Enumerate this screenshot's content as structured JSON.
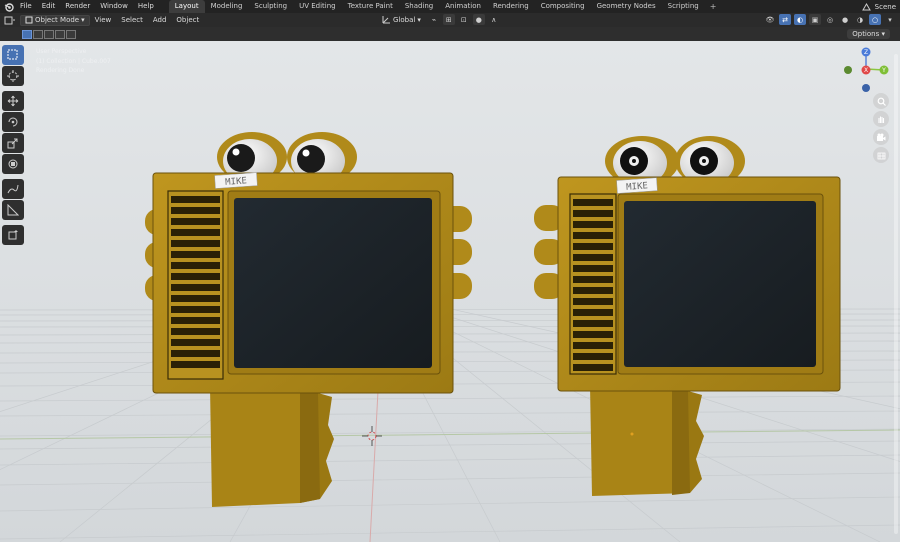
{
  "menubar": {
    "items": [
      "File",
      "Edit",
      "Render",
      "Window",
      "Help"
    ],
    "workspaces": [
      "Layout",
      "Modeling",
      "Sculpting",
      "UV Editing",
      "Texture Paint",
      "Shading",
      "Animation",
      "Rendering",
      "Compositing",
      "Geometry Nodes",
      "Scripting"
    ],
    "active_workspace": "Layout",
    "add_tab": "+",
    "scene": "Scene"
  },
  "header": {
    "mode": "Object Mode",
    "menus": [
      "View",
      "Select",
      "Add",
      "Object"
    ],
    "orientation": "Global",
    "options": "Options"
  },
  "viewport": {
    "overlay_lines": [
      "User Perspective",
      "(1) Collection | Cube.007",
      "Rendering Done"
    ],
    "label_left": "MIKE",
    "label_right": "MIKE"
  },
  "gizmo": {
    "x": "X",
    "y": "Y",
    "z": "Z"
  },
  "colors": {
    "body": "#b08a1a",
    "body_dark": "#7d6110",
    "screen": "#1d2328",
    "viewport_bg": "#dfe3e5",
    "accent": "#4772b3"
  }
}
